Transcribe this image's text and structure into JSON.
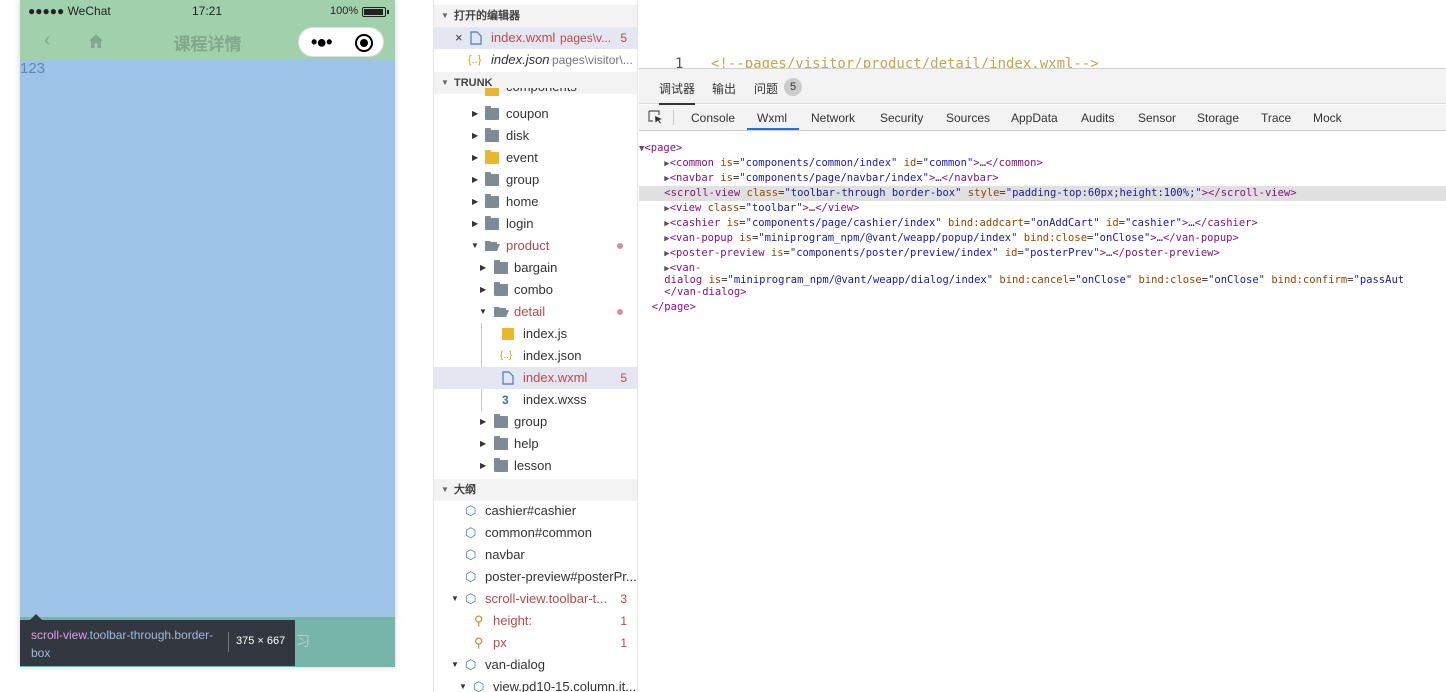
{
  "simulator": {
    "status": {
      "carrier": "●●●●● WeChat",
      "time": "17:21",
      "battery": "100%"
    },
    "nav": {
      "title": "课程详情",
      "capsule_more": "•●•"
    },
    "content_text": "123",
    "bottom_hint": "习",
    "inspect_tooltip": {
      "tag": "scroll-view",
      "classes": ".toolbar-through.border-box",
      "size": "375 × 667"
    }
  },
  "explorer": {
    "open_editors_header": "打开的编辑器",
    "open_editors": [
      {
        "close": "×",
        "name": "index.wxml",
        "path": "pages\\v...",
        "badge": "5"
      },
      {
        "icon": "{..}",
        "name": "index.json",
        "path": "pages\\visitor\\..."
      }
    ],
    "trunk_header": "TRUNK",
    "tree": [
      {
        "name": "components"
      },
      {
        "name": "coupon"
      },
      {
        "name": "disk"
      },
      {
        "name": "event"
      },
      {
        "name": "group"
      },
      {
        "name": "home"
      },
      {
        "name": "login"
      },
      {
        "name": "product"
      },
      {
        "name": "bargain"
      },
      {
        "name": "combo"
      },
      {
        "name": "detail"
      },
      {
        "name": "index.js"
      },
      {
        "name": "index.json"
      },
      {
        "name": "index.wxml",
        "badge": "5"
      },
      {
        "name": "index.wxss"
      },
      {
        "name": "group"
      },
      {
        "name": "help"
      },
      {
        "name": "lesson"
      }
    ],
    "outline_header": "大纲",
    "outline": [
      {
        "name": "cashier#cashier"
      },
      {
        "name": "common#common"
      },
      {
        "name": "navbar"
      },
      {
        "name": "poster-preview#posterPr..."
      },
      {
        "name": "scroll-view.toolbar-t...",
        "badge": "3"
      },
      {
        "name": "height:",
        "badge": "1"
      },
      {
        "name": "px",
        "badge": "1"
      },
      {
        "name": "van-dialog"
      },
      {
        "name": "view.pd10-15.column.it..."
      }
    ]
  },
  "editor": {
    "line_number": "1",
    "code": "<!--pages/visitor/product/detail/index.wxml-->"
  },
  "devtools": {
    "top_tabs": [
      "调试器",
      "输出",
      "问题"
    ],
    "problem_count": "5",
    "panel_tabs": [
      "Console",
      "Wxml",
      "Network",
      "Security",
      "Sources",
      "AppData",
      "Audits",
      "Sensor",
      "Storage",
      "Trace",
      "Mock"
    ],
    "active_panel": "Wxml",
    "dom": {
      "page_open": "<page>",
      "common_tag": "common",
      "common_is": "components/common/index",
      "common_id": "common",
      "navbar_tag": "navbar",
      "navbar_is": "components/page/navbar/index",
      "scroll_tag": "scroll-view",
      "scroll_class": "toolbar-through border-box",
      "scroll_style": "padding-top:60px;height:100%;",
      "view_tag": "view",
      "view_class": "toolbar",
      "cashier_tag": "cashier",
      "cashier_is": "components/page/cashier/index",
      "cashier_addcart": "onAddCart",
      "cashier_id": "cashier",
      "popup_tag": "van-popup",
      "popup_is": "miniprogram_npm/@vant/weapp/popup/index",
      "popup_close": "onClose",
      "poster_tag": "poster-preview",
      "poster_is": "components/poster/preview/index",
      "poster_id": "posterPrev",
      "dialog_tag_a": "van-",
      "dialog_tag_b": "dialog",
      "dialog_is": "miniprogram_npm/@vant/weapp/dialog/index",
      "dialog_cancel": "onClose",
      "dialog_close": "onClose",
      "dialog_confirm": "passAut",
      "dialog_close_tag": "</van-dialog>",
      "page_close": "</page>"
    }
  }
}
